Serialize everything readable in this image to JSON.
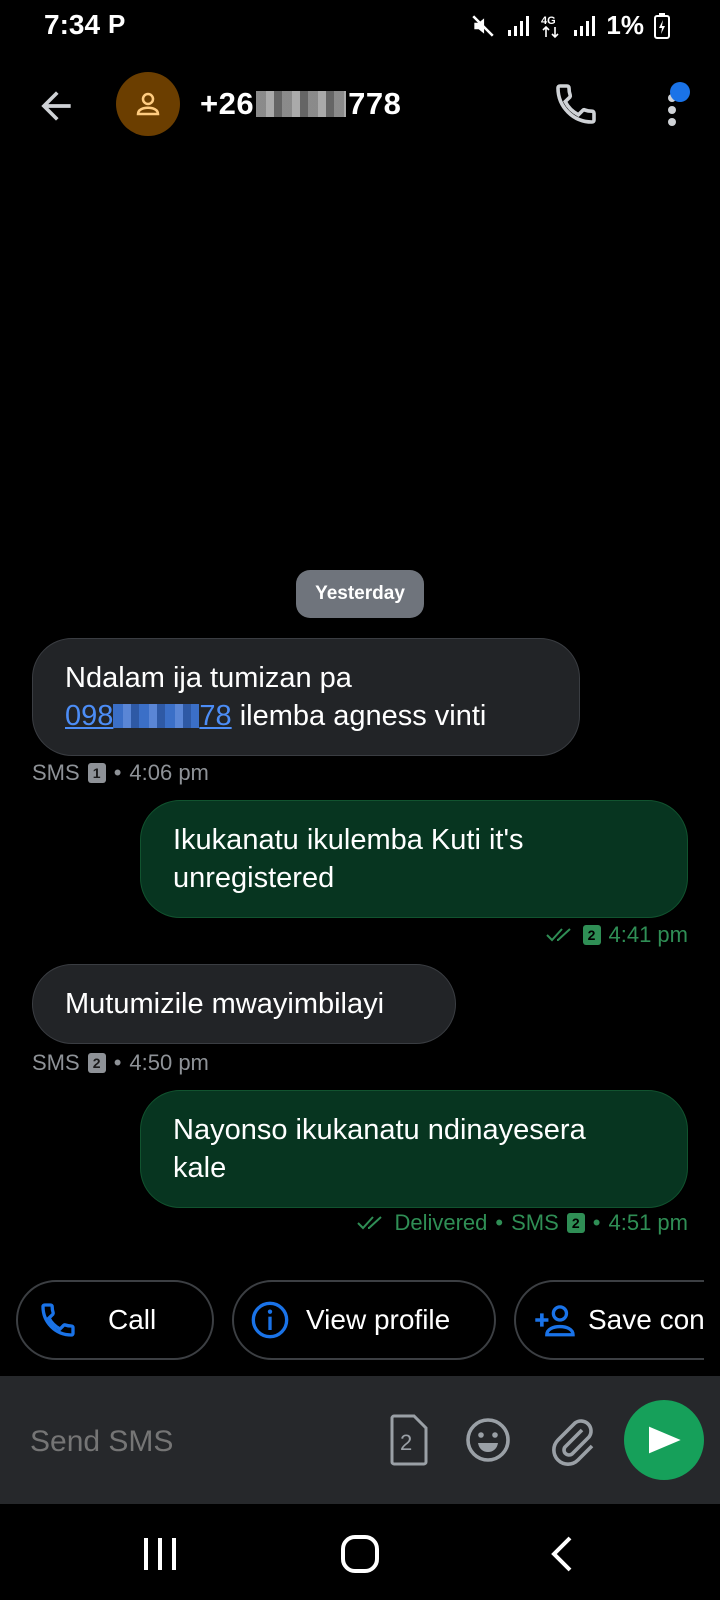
{
  "status_bar": {
    "time": "7:34",
    "parking_glyph": "P",
    "battery_text": "1%",
    "icons": [
      "mute-icon",
      "signal-icon",
      "4g-icon",
      "signal-icon",
      "battery-charging-icon"
    ]
  },
  "header": {
    "number_prefix": "+26",
    "number_suffix": "778",
    "back_icon": "back-arrow-icon",
    "avatar_icon": "person-icon",
    "call_icon": "phone-icon",
    "menu_icon": "more-vert-icon",
    "avatar_color": "#6b3e00"
  },
  "date_chip": "Yesterday",
  "messages": [
    {
      "direction": "in",
      "line1": "Ndalam ija tumizan pa",
      "link_prefix": "098",
      "link_suffix": "78",
      "line2_rest": " ilemba agness vinti",
      "meta_label": "SMS",
      "sim": "1",
      "time": "4:06 pm"
    },
    {
      "direction": "out",
      "line1": "Ikukanatu ikulemba Kuti it's",
      "line2": "unregistered",
      "sim": "2",
      "time": "4:41 pm"
    },
    {
      "direction": "in",
      "line1": "Mutumizile mwayimbilayi",
      "meta_label": "SMS",
      "sim": "2",
      "time": "4:50 pm"
    },
    {
      "direction": "out",
      "line1": "Nayonso ikukanatu ndinayesera",
      "line2": "kale",
      "status": "Delivered",
      "meta_label": "SMS",
      "sim": "2",
      "time": "4:51 pm"
    }
  ],
  "meta_separator": "•",
  "actions": {
    "call": "Call",
    "view_profile": "View profile",
    "save_contact": "Save con"
  },
  "composer": {
    "placeholder": "Send SMS",
    "sim_number": "2"
  },
  "colors": {
    "incoming_bubble": "#222427",
    "outgoing_bubble": "#073520",
    "accent_blue": "#1a73e8",
    "send_green": "#16a05a",
    "meta_green": "#2f8e55"
  }
}
